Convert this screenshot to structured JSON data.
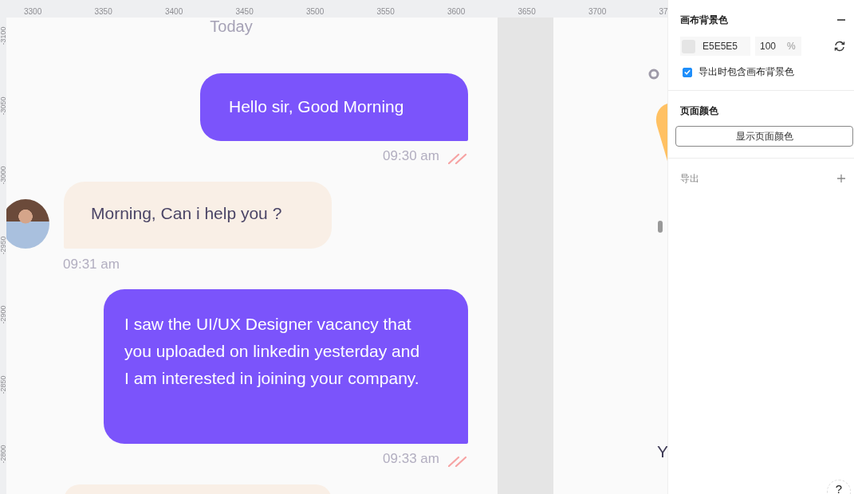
{
  "ruler": {
    "x_labels": [
      "3300",
      "3350",
      "3400",
      "3450",
      "3500",
      "3550",
      "3600",
      "3650",
      "3700",
      "37"
    ],
    "y_labels": [
      "-3100",
      "-3050",
      "-3000",
      "-2950",
      "-2900",
      "-2850",
      "-2800"
    ]
  },
  "chat": {
    "date_label": "Today",
    "messages": [
      {
        "kind": "sent",
        "text": "Hello sir, Good Morning",
        "time": "09:30 am",
        "read": true
      },
      {
        "kind": "received",
        "text": "Morning, Can i help you ?",
        "time": "09:31 am",
        "avatar": true
      },
      {
        "kind": "sent",
        "text": "I saw the UI/UX Designer vacancy that you uploaded on linkedin yesterday and I am interested in joining your company.",
        "time": "09:33 am",
        "read": true
      },
      {
        "kind": "received",
        "avatar": false
      }
    ]
  },
  "second_frame": {
    "text": "Y"
  },
  "panel": {
    "canvas_background": {
      "title": "画布背景色",
      "hex": "E5E5E5",
      "opacity": "100",
      "unit": "%",
      "include_on_export": {
        "label": "导出时包含画布背景色",
        "checked": true
      }
    },
    "page_color": {
      "title": "页面颜色",
      "button": "显示页面颜色"
    },
    "export": {
      "title": "导出"
    },
    "help": "?"
  }
}
